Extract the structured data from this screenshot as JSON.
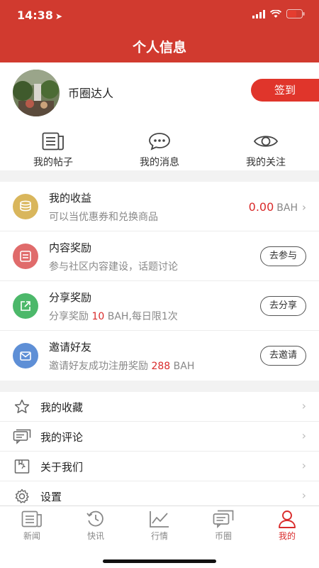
{
  "status_bar": {
    "time": "14:38"
  },
  "header": {
    "title": "个人信息"
  },
  "profile": {
    "username": "币圈达人",
    "signin_label": "签到"
  },
  "quick_links": [
    {
      "label": "我的帖子",
      "icon": "posts-icon"
    },
    {
      "label": "我的消息",
      "icon": "chat-bubble-icon"
    },
    {
      "label": "我的关注",
      "icon": "eye-icon"
    }
  ],
  "rewards": [
    {
      "title": "我的收益",
      "subtitle": "可以当优惠券和兑换商品",
      "amount": "0.00",
      "unit": "BAH",
      "icon": "coin-stack-icon",
      "color": "#d9b65c"
    },
    {
      "title": "内容奖励",
      "subtitle": "参与社区内容建设，话题讨论",
      "action": "去参与",
      "icon": "document-icon",
      "color": "#e06b6b"
    },
    {
      "title": "分享奖励",
      "subtitle_prefix": "分享奖励 ",
      "subtitle_highlight": "10",
      "subtitle_suffix": " BAH,每日限1次",
      "action": "去分享",
      "icon": "share-icon",
      "color": "#4cb86a"
    },
    {
      "title": "邀请好友",
      "subtitle_prefix": "邀请好友成功注册奖励 ",
      "subtitle_highlight": "288",
      "subtitle_suffix": " BAH",
      "action": "去邀请",
      "icon": "mail-icon",
      "color": "#5e8fd6"
    }
  ],
  "menu": [
    {
      "label": "我的收藏",
      "icon": "star-icon"
    },
    {
      "label": "我的评论",
      "icon": "comment-icon"
    },
    {
      "label": "关于我们",
      "icon": "about-icon"
    },
    {
      "label": "设置",
      "icon": "gear-icon"
    }
  ],
  "tabbar": [
    {
      "label": "新闻",
      "icon": "news-icon"
    },
    {
      "label": "快讯",
      "icon": "flash-clock-icon"
    },
    {
      "label": "行情",
      "icon": "market-chart-icon"
    },
    {
      "label": "币圈",
      "icon": "community-icon"
    },
    {
      "label": "我的",
      "icon": "user-icon",
      "active": true
    }
  ],
  "colors": {
    "brand": "#d13a2f",
    "accent_red": "#d92b2b",
    "tab_active": "#d92b2b"
  }
}
